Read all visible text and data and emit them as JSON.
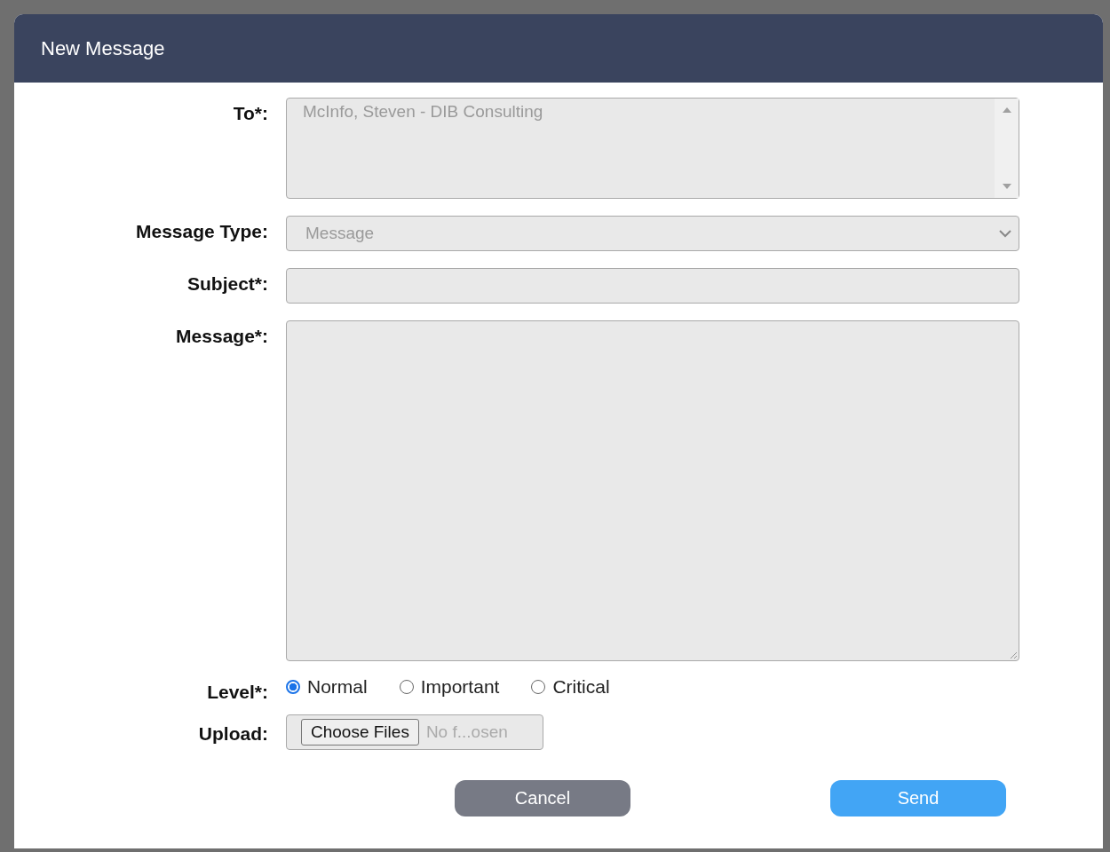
{
  "dialog": {
    "title": "New Message"
  },
  "fields": [
    {
      "kind": "list",
      "label": "To*:",
      "value": "McInfo, Steven - DIB Consulting"
    },
    {
      "kind": "select",
      "label": "Message Type:",
      "value": "Message"
    },
    {
      "kind": "text",
      "label": "Subject*:"
    },
    {
      "kind": "textarea",
      "label": "Message*:"
    },
    {
      "kind": "radios",
      "label": "Level*:",
      "options": [
        {
          "label": "Normal",
          "selected": true
        },
        {
          "label": "Important",
          "selected": false
        },
        {
          "label": "Critical",
          "selected": false
        }
      ]
    },
    {
      "kind": "file",
      "label": "Upload:",
      "button": "Choose Files",
      "status": "No f...osen"
    }
  ],
  "buttons": [
    {
      "kind": "secondary",
      "label": "Cancel"
    },
    {
      "kind": "primary",
      "label": "Send"
    }
  ]
}
